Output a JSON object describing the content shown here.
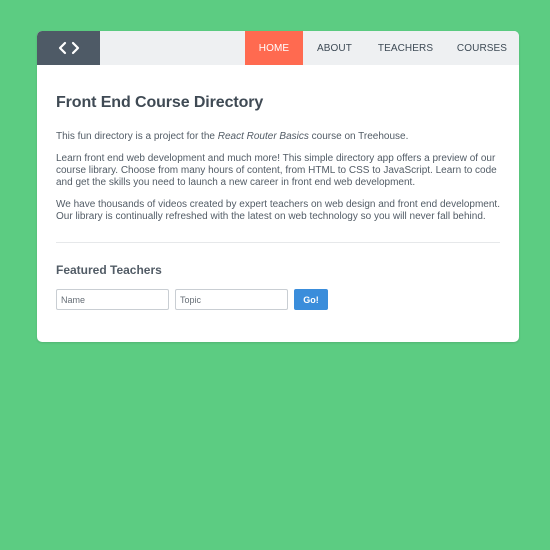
{
  "nav": {
    "logo_icon": "code-brackets-icon",
    "links": [
      {
        "label": "HOME",
        "active": true
      },
      {
        "label": "ABOUT",
        "active": false
      },
      {
        "label": "TEACHERS",
        "active": false
      },
      {
        "label": "COURSES",
        "active": false
      }
    ]
  },
  "main": {
    "title": "Front End Course Directory",
    "intro": {
      "before": "This fun directory is a project for the ",
      "emphasis": "React Router Basics",
      "after": " course on Treehouse."
    },
    "paragraph2": "Learn front end web development and much more! This simple directory app offers a preview of our course library. Choose from many hours of content, from HTML to CSS to JavaScript. Learn to code and get the skills you need to launch a new career in front end web development.",
    "paragraph3": "We have thousands of videos created by expert teachers on web design and front end development. Our library is continually refreshed with the latest on web technology so you will never fall behind."
  },
  "featured": {
    "heading": "Featured Teachers",
    "name_placeholder": "Name",
    "topic_placeholder": "Topic",
    "submit_label": "Go!"
  },
  "colors": {
    "background": "#5ccc82",
    "nav_bg": "#eef0f2",
    "logo_bg": "#4e5a66",
    "active_nav": "#ff6a50",
    "button": "#3a8ddb"
  }
}
